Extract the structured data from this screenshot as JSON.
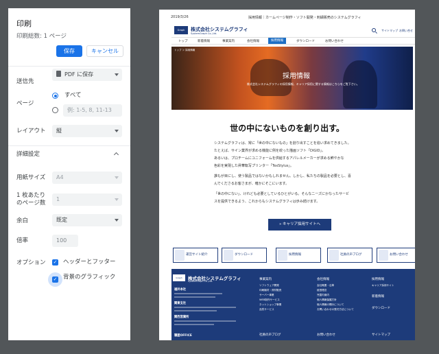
{
  "panel": {
    "title": "印刷",
    "sheets": "印刷総数: 1 ページ",
    "save": "保存",
    "cancel": "キャンセル",
    "destination_label": "送信先",
    "destination_value": "PDF に保存",
    "pages_label": "ページ",
    "pages_all": "すべて",
    "pages_range_placeholder": "例: 1-5, 8, 11-13",
    "layout_label": "レイアウト",
    "layout_value": "縦",
    "more_settings": "詳細設定",
    "paper_size_label": "用紙サイズ",
    "paper_size_value": "A4",
    "pages_per_sheet_label_1": "1 枚あたり",
    "pages_per_sheet_label_2": "のページ数",
    "pages_per_sheet_value": "1",
    "margins_label": "余白",
    "margins_value": "既定",
    "scale_label": "倍率",
    "scale_value": "100",
    "options_label": "オプション",
    "opt_headers": "ヘッダーとフッター",
    "opt_bg": "背景のグラフィック"
  },
  "preview": {
    "date": "2019/3/26",
    "doc_title": "採用情報｜カームページ制作・ソフト開発・刺繍販売のシステムグラフィ",
    "logo_mark": "Graph",
    "company": "株式会社システムグラフィ",
    "company_en": "SystemGraph Co.,Ltd.",
    "top_link1": "サイトマップ",
    "top_link2": "お問い合せ",
    "nav": [
      "トップ",
      "新着情報",
      "事業案内",
      "会社情報",
      "採用情報",
      "ダウンロード",
      "お問い合わせ"
    ],
    "breadcrumb": "トップ ＞ 採用情報",
    "hero_title": "採用情報",
    "hero_sub": "株式会社システムグラフィの採用情報、キャリア採用に関する情報はこちらをご覧下さい。",
    "catch": "世の中にないものを創り出す。",
    "paragraphs": [
      "システムグラフィは、常に「世の中にないもの」を創り出すことを追い求めてきました。",
      "たとえば、サイン業界が求める機能に例を絞った描画ソフト「DIGID」。",
      "あるいは、プロチームにユニフォームを供給するアパレルメーカーが求める鮮やかな",
      "色彩を実現した昇華転写プリンター「TexStylus」。",
      "誰もが目にし、使う製品ではないかもしれません。しかし、私たちの製品を必要とし、喜",
      "んでくださるお客さまが、確かにそこにいます。",
      "「世の中にない」、けれども必要としているひとがいる。そんなニーズにかなったサービ",
      "スを提供できるよう、これからもシステムグラフィは歩み続けます。"
    ],
    "career_btn": "» キャリア採用サイトへ",
    "banners": [
      "運営サイト紹介",
      "ダウンロード",
      "採用情報",
      "社員の声ブログ",
      "お問い合わせ"
    ],
    "footer": {
      "logo_mark": "Graph",
      "name": "株式会社システムグラフィ",
      "sub": "SystemGraph Co.,Ltd.",
      "office1": "福井本社",
      "office2": "関東支社",
      "office3": "関西営業所",
      "office4": "寝屋OFFICE",
      "col1_title": "事業案内",
      "col1_items": [
        "ソフトウェア開発",
        "印刷機材・資材販売",
        "サーバー事業",
        "WEB制作サービス",
        "ネットショップ事業",
        "品質サービス"
      ],
      "col2_title": "会社情報",
      "col2_items": [
        "会社概要・沿革",
        "経営理念",
        "児童内案内",
        "個人情報保護方針",
        "個人情報の開示について",
        "お問い合わせの受付方法について"
      ],
      "col3_title": "採用情報",
      "col3_items": [
        "キャリア採用サイト"
      ],
      "col3b_title": "新着情報",
      "col3c_title": "ダウンロード",
      "bottom1": "社員の声ブログ",
      "bottom2": "お問い合わせ",
      "bottom3": "サイトマップ"
    }
  }
}
